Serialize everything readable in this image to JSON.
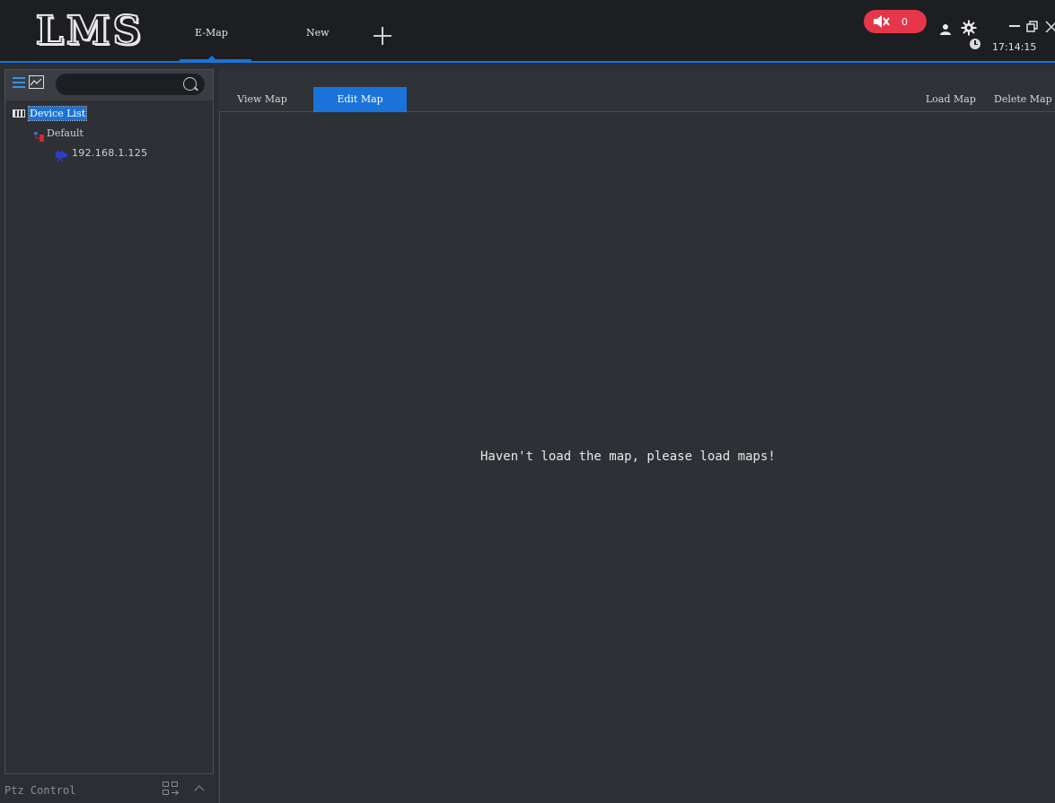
{
  "app": {
    "logo_text": "LMS",
    "tabs": [
      {
        "label": "E-Map",
        "active": true
      },
      {
        "label": "New",
        "active": false
      }
    ],
    "add_tab_icon": "plus-icon",
    "alarm": {
      "icon": "mute-speaker-icon",
      "count": "0",
      "color": "#e6364a"
    },
    "clock": {
      "icon": "clock-icon",
      "time": "17:14:15"
    },
    "accent_color": "#1a73d9"
  },
  "sidebar": {
    "search": {
      "placeholder": ""
    },
    "tree": {
      "root": {
        "label": "Device List",
        "icon": "device-list-icon",
        "selected": true
      },
      "group": {
        "label": "Default",
        "icon": "group-icon"
      },
      "device": {
        "label": "192.168.1.125",
        "icon": "camera-icon"
      }
    },
    "ptz": {
      "label": "Ptz Control"
    }
  },
  "map": {
    "modes": [
      {
        "label": "View Map",
        "active": false
      },
      {
        "label": "Edit Map",
        "active": true
      }
    ],
    "actions": {
      "load": "Load Map",
      "delete": "Delete Map"
    },
    "empty_message": "Haven't load the map, please load maps!"
  }
}
